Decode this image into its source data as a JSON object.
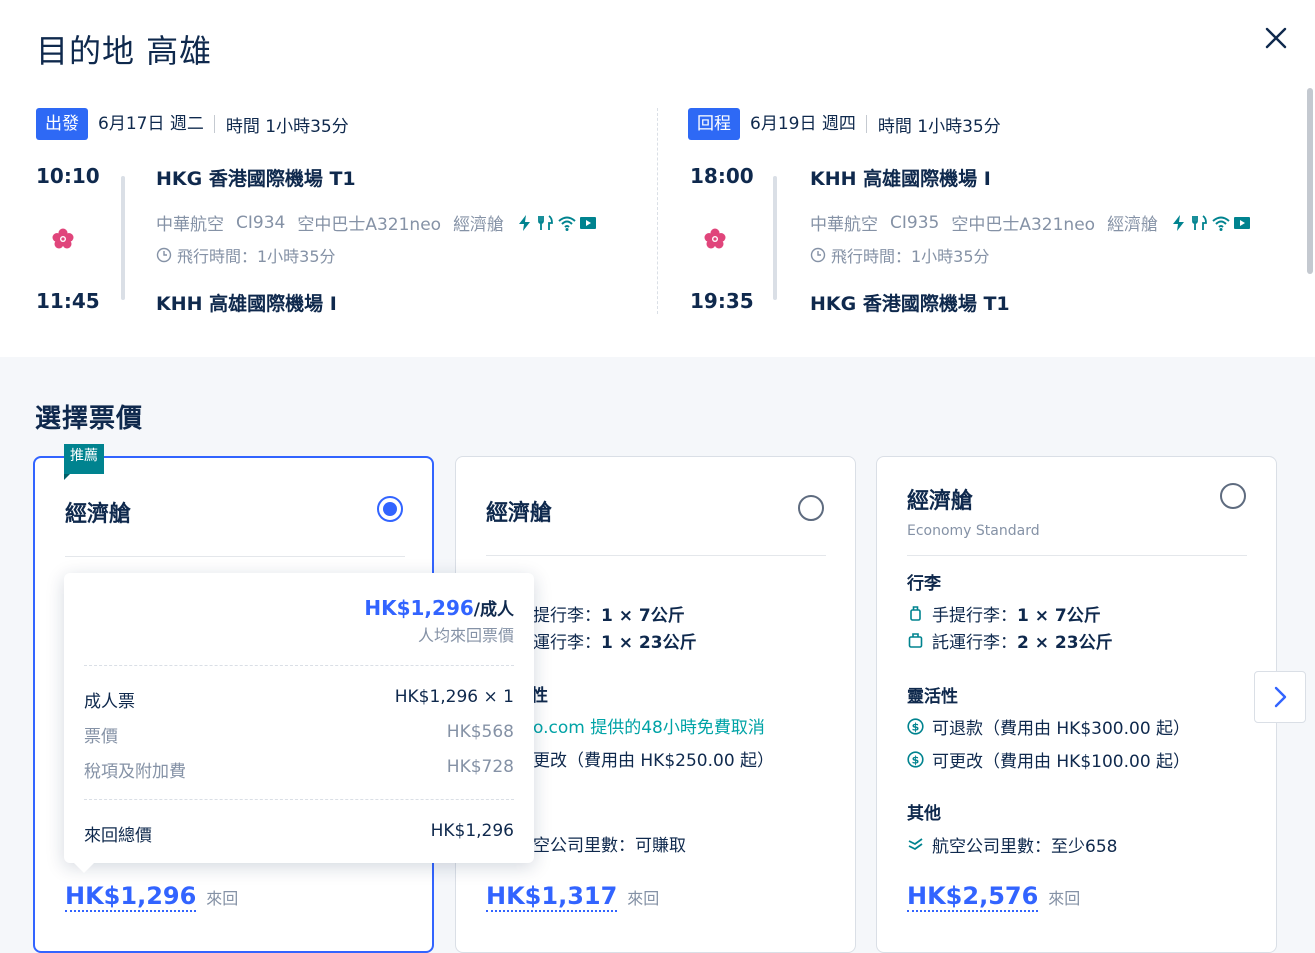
{
  "header": {
    "title": "目的地 高雄"
  },
  "outbound": {
    "badge": "出發",
    "date": "6月17日 週二",
    "duration": "時間 1小時35分",
    "dep_time": "10:10",
    "dep_airport": "HKG 香港國際機場 T1",
    "airline": "中華航空",
    "flight_no": "CI934",
    "aircraft": "空中巴士A321neo",
    "cabin": "經濟艙",
    "flight_time": "飛行時間：1小時35分",
    "arr_time": "11:45",
    "arr_airport": "KHH 高雄國際機場 I"
  },
  "inbound": {
    "badge": "回程",
    "date": "6月19日 週四",
    "duration": "時間 1小時35分",
    "dep_time": "18:00",
    "dep_airport": "KHH 高雄國際機場 I",
    "airline": "中華航空",
    "flight_no": "CI935",
    "aircraft": "空中巴士A321neo",
    "cabin": "經濟艙",
    "flight_time": "飛行時間：1小時35分",
    "arr_time": "19:35",
    "arr_airport": "HKG 香港國際機場 T1"
  },
  "fares": {
    "section_title": "選擇票價",
    "recommend_tag": "推薦",
    "cards": [
      {
        "title": "經濟艙",
        "price": "HK$1,296",
        "unit": "來回",
        "selected": true
      },
      {
        "title": "經濟艙",
        "baggage_partial": "行李",
        "carry_on_text": "提行李：",
        "carry_on_val": "1 × 7公斤",
        "checked_text": "運行李：",
        "checked_val": "1 × 23公斤",
        "flex_partial": "性",
        "free_cancel": "o.com 提供的48小時免費取消",
        "change": "更改（費用由 HK$250.00 起）",
        "miles": "空公司里數：可賺取",
        "price": "HK$1,317",
        "unit": "來回"
      },
      {
        "title": "經濟艙",
        "subtitle": "Economy Standard",
        "baggage_title": "行李",
        "carry_on_text": "手提行李：",
        "carry_on_val": "1 × 7公斤",
        "checked_text": "託運行李：",
        "checked_val": "2 × 23公斤",
        "flex_title": "靈活性",
        "refund": "可退款（費用由 HK$300.00 起）",
        "change": "可更改（費用由 HK$100.00 起）",
        "other_title": "其他",
        "miles": "航空公司里數：至少658",
        "price": "HK$2,576",
        "unit": "來回"
      }
    ]
  },
  "popup": {
    "price": "HK$1,296",
    "per": "/成人",
    "note": "人均來回票價",
    "adult_label": "成人票",
    "adult_val": "HK$1,296 × 1",
    "fare_label": "票價",
    "fare_val": "HK$568",
    "tax_label": "稅項及附加費",
    "tax_val": "HK$728",
    "total_label": "來回總價",
    "total_val": "HK$1,296"
  },
  "colors": {
    "accent": "#3264ff",
    "badge": "#2e69f5",
    "teal": "#00838f",
    "text": "#0f294d",
    "muted": "#8592a6"
  }
}
